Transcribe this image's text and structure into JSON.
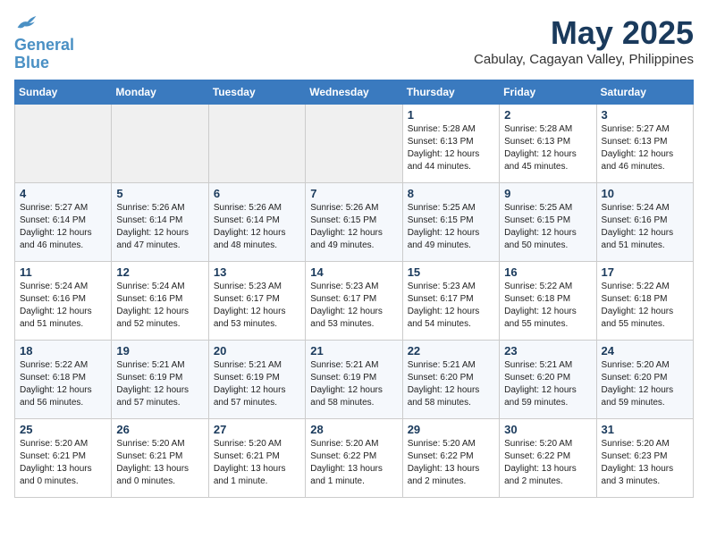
{
  "header": {
    "logo_line1": "General",
    "logo_line2": "Blue",
    "month_title": "May 2025",
    "subtitle": "Cabulay, Cagayan Valley, Philippines"
  },
  "days_of_week": [
    "Sunday",
    "Monday",
    "Tuesday",
    "Wednesday",
    "Thursday",
    "Friday",
    "Saturday"
  ],
  "weeks": [
    [
      {
        "day": "",
        "info": ""
      },
      {
        "day": "",
        "info": ""
      },
      {
        "day": "",
        "info": ""
      },
      {
        "day": "",
        "info": ""
      },
      {
        "day": "1",
        "info": "Sunrise: 5:28 AM\nSunset: 6:13 PM\nDaylight: 12 hours\nand 44 minutes."
      },
      {
        "day": "2",
        "info": "Sunrise: 5:28 AM\nSunset: 6:13 PM\nDaylight: 12 hours\nand 45 minutes."
      },
      {
        "day": "3",
        "info": "Sunrise: 5:27 AM\nSunset: 6:13 PM\nDaylight: 12 hours\nand 46 minutes."
      }
    ],
    [
      {
        "day": "4",
        "info": "Sunrise: 5:27 AM\nSunset: 6:14 PM\nDaylight: 12 hours\nand 46 minutes."
      },
      {
        "day": "5",
        "info": "Sunrise: 5:26 AM\nSunset: 6:14 PM\nDaylight: 12 hours\nand 47 minutes."
      },
      {
        "day": "6",
        "info": "Sunrise: 5:26 AM\nSunset: 6:14 PM\nDaylight: 12 hours\nand 48 minutes."
      },
      {
        "day": "7",
        "info": "Sunrise: 5:26 AM\nSunset: 6:15 PM\nDaylight: 12 hours\nand 49 minutes."
      },
      {
        "day": "8",
        "info": "Sunrise: 5:25 AM\nSunset: 6:15 PM\nDaylight: 12 hours\nand 49 minutes."
      },
      {
        "day": "9",
        "info": "Sunrise: 5:25 AM\nSunset: 6:15 PM\nDaylight: 12 hours\nand 50 minutes."
      },
      {
        "day": "10",
        "info": "Sunrise: 5:24 AM\nSunset: 6:16 PM\nDaylight: 12 hours\nand 51 minutes."
      }
    ],
    [
      {
        "day": "11",
        "info": "Sunrise: 5:24 AM\nSunset: 6:16 PM\nDaylight: 12 hours\nand 51 minutes."
      },
      {
        "day": "12",
        "info": "Sunrise: 5:24 AM\nSunset: 6:16 PM\nDaylight: 12 hours\nand 52 minutes."
      },
      {
        "day": "13",
        "info": "Sunrise: 5:23 AM\nSunset: 6:17 PM\nDaylight: 12 hours\nand 53 minutes."
      },
      {
        "day": "14",
        "info": "Sunrise: 5:23 AM\nSunset: 6:17 PM\nDaylight: 12 hours\nand 53 minutes."
      },
      {
        "day": "15",
        "info": "Sunrise: 5:23 AM\nSunset: 6:17 PM\nDaylight: 12 hours\nand 54 minutes."
      },
      {
        "day": "16",
        "info": "Sunrise: 5:22 AM\nSunset: 6:18 PM\nDaylight: 12 hours\nand 55 minutes."
      },
      {
        "day": "17",
        "info": "Sunrise: 5:22 AM\nSunset: 6:18 PM\nDaylight: 12 hours\nand 55 minutes."
      }
    ],
    [
      {
        "day": "18",
        "info": "Sunrise: 5:22 AM\nSunset: 6:18 PM\nDaylight: 12 hours\nand 56 minutes."
      },
      {
        "day": "19",
        "info": "Sunrise: 5:21 AM\nSunset: 6:19 PM\nDaylight: 12 hours\nand 57 minutes."
      },
      {
        "day": "20",
        "info": "Sunrise: 5:21 AM\nSunset: 6:19 PM\nDaylight: 12 hours\nand 57 minutes."
      },
      {
        "day": "21",
        "info": "Sunrise: 5:21 AM\nSunset: 6:19 PM\nDaylight: 12 hours\nand 58 minutes."
      },
      {
        "day": "22",
        "info": "Sunrise: 5:21 AM\nSunset: 6:20 PM\nDaylight: 12 hours\nand 58 minutes."
      },
      {
        "day": "23",
        "info": "Sunrise: 5:21 AM\nSunset: 6:20 PM\nDaylight: 12 hours\nand 59 minutes."
      },
      {
        "day": "24",
        "info": "Sunrise: 5:20 AM\nSunset: 6:20 PM\nDaylight: 12 hours\nand 59 minutes."
      }
    ],
    [
      {
        "day": "25",
        "info": "Sunrise: 5:20 AM\nSunset: 6:21 PM\nDaylight: 13 hours\nand 0 minutes."
      },
      {
        "day": "26",
        "info": "Sunrise: 5:20 AM\nSunset: 6:21 PM\nDaylight: 13 hours\nand 0 minutes."
      },
      {
        "day": "27",
        "info": "Sunrise: 5:20 AM\nSunset: 6:21 PM\nDaylight: 13 hours\nand 1 minute."
      },
      {
        "day": "28",
        "info": "Sunrise: 5:20 AM\nSunset: 6:22 PM\nDaylight: 13 hours\nand 1 minute."
      },
      {
        "day": "29",
        "info": "Sunrise: 5:20 AM\nSunset: 6:22 PM\nDaylight: 13 hours\nand 2 minutes."
      },
      {
        "day": "30",
        "info": "Sunrise: 5:20 AM\nSunset: 6:22 PM\nDaylight: 13 hours\nand 2 minutes."
      },
      {
        "day": "31",
        "info": "Sunrise: 5:20 AM\nSunset: 6:23 PM\nDaylight: 13 hours\nand 3 minutes."
      }
    ]
  ]
}
